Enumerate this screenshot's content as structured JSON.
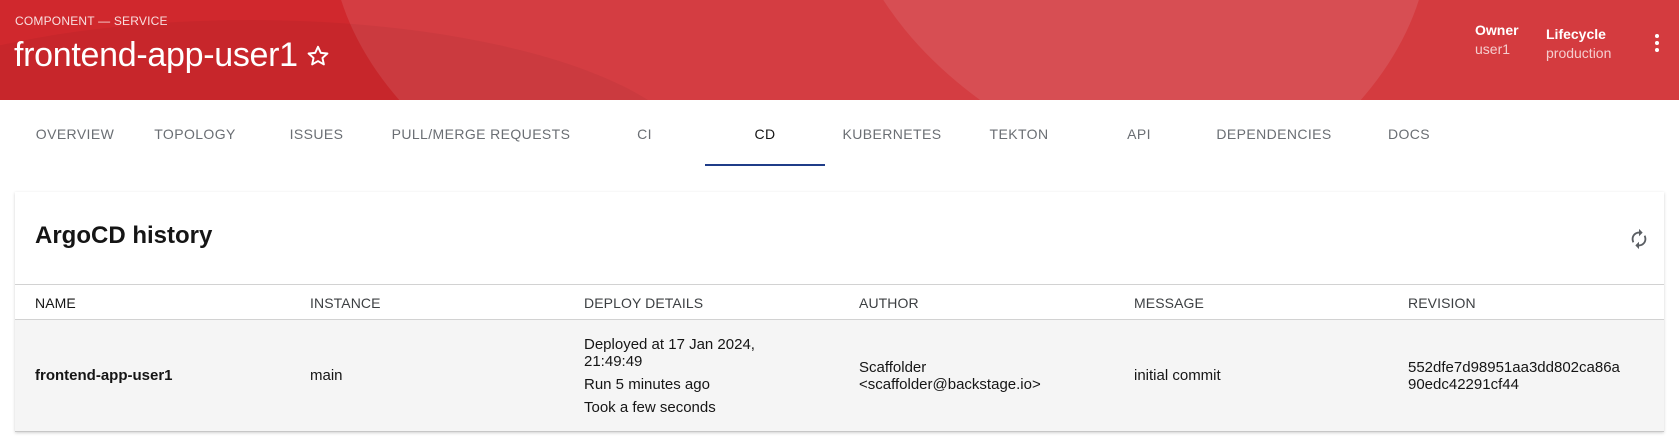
{
  "header": {
    "kind": "COMPONENT — SERVICE",
    "title": "frontend-app-user1",
    "owner_label": "Owner",
    "owner_value": "user1",
    "lifecycle_label": "Lifecycle",
    "lifecycle_value": "production"
  },
  "tabs": [
    {
      "label": "OVERVIEW"
    },
    {
      "label": "TOPOLOGY"
    },
    {
      "label": "ISSUES"
    },
    {
      "label": "PULL/MERGE REQUESTS"
    },
    {
      "label": "CI"
    },
    {
      "label": "CD"
    },
    {
      "label": "KUBERNETES"
    },
    {
      "label": "TEKTON"
    },
    {
      "label": "API"
    },
    {
      "label": "DEPENDENCIES"
    },
    {
      "label": "DOCS"
    }
  ],
  "active_tab": "CD",
  "card": {
    "title": "ArgoCD history",
    "columns": [
      "NAME",
      "INSTANCE",
      "DEPLOY DETAILS",
      "AUTHOR",
      "MESSAGE",
      "REVISION"
    ],
    "rows": [
      {
        "name": "frontend-app-user1",
        "instance": "main",
        "deploy_details": {
          "deployed_at_1": "Deployed at 17 Jan 2024,",
          "deployed_at_2": "21:49:49",
          "run": "Run 5 minutes ago",
          "took": "Took a few seconds"
        },
        "author_1": "Scaffolder",
        "author_2": "<scaffolder@backstage.io>",
        "message": "initial commit",
        "revision_1": "552dfe7d98951aa3dd802ca86a",
        "revision_2": "90edc42291cf44"
      }
    ]
  },
  "colors": {
    "header_bg": "#d0282d",
    "active_tab_indicator": "#1f3c88",
    "row_bg": "#f5f5f5"
  },
  "icons": {
    "favorite": "star-outline-icon",
    "more": "kebab-vertical-icon",
    "refresh": "refresh-icon"
  }
}
